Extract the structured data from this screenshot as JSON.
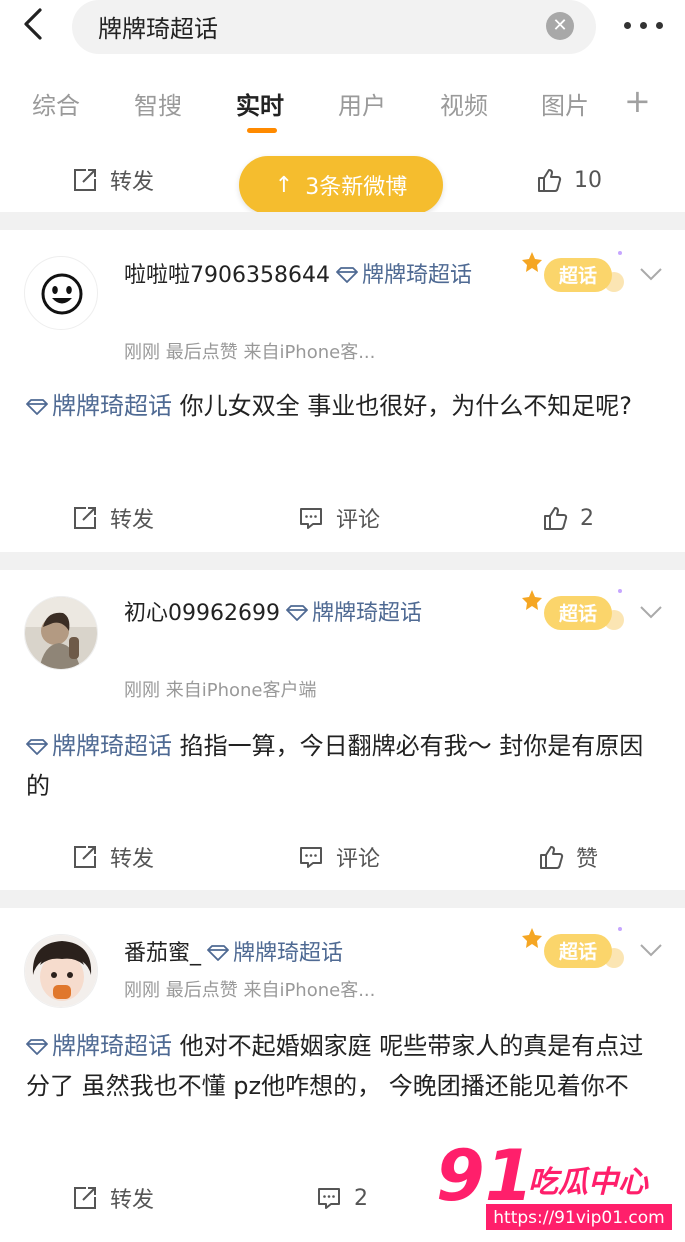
{
  "search": {
    "query": "牌牌琦超话"
  },
  "tabs": [
    {
      "label": "综合",
      "active": false
    },
    {
      "label": "智搜",
      "active": false
    },
    {
      "label": "实时",
      "active": true
    },
    {
      "label": "用户",
      "active": false
    },
    {
      "label": "视频",
      "active": false
    },
    {
      "label": "图片",
      "active": false
    }
  ],
  "new_posts_pill": "3条新微博",
  "top_actions": {
    "repost": "转发",
    "likes": "10"
  },
  "badge_label": "超话",
  "posts": [
    {
      "username": "啦啦啦7906358644",
      "supertopic": "牌牌琦超话",
      "meta": "刚刚 最后点赞 来自iPhone客...",
      "tag": "牌牌琦超话",
      "text": "你儿女双全 事业也很好，为什么不知足呢?",
      "repost": "转发",
      "comment": "评论",
      "like": "2"
    },
    {
      "username": "初心09962699",
      "supertopic": "牌牌琦超话",
      "meta": "刚刚 来自iPhone客户端",
      "tag": "牌牌琦超话",
      "text": "掐指一算，今日翻牌必有我～ 封你是有原因的",
      "repost": "转发",
      "comment": "评论",
      "like": "赞"
    },
    {
      "username": "番茄蜜_",
      "supertopic": "牌牌琦超话",
      "meta": "刚刚 最后点赞 来自iPhone客...",
      "tag": "牌牌琦超话",
      "text": "他对不起婚姻家庭 呢些带家人的真是有点过分了 虽然我也不懂 pz他咋想的， 今晚团播还能见着你不",
      "repost": "转发",
      "comment": "2"
    }
  ],
  "watermark": {
    "brand": "91",
    "label": "吃瓜中心",
    "url": "https://91vip01.com"
  },
  "colors": {
    "accent": "#ff8a00",
    "pill": "#f5bd2e",
    "tag": "#4f6a93",
    "separator": "#f1f1f1"
  }
}
